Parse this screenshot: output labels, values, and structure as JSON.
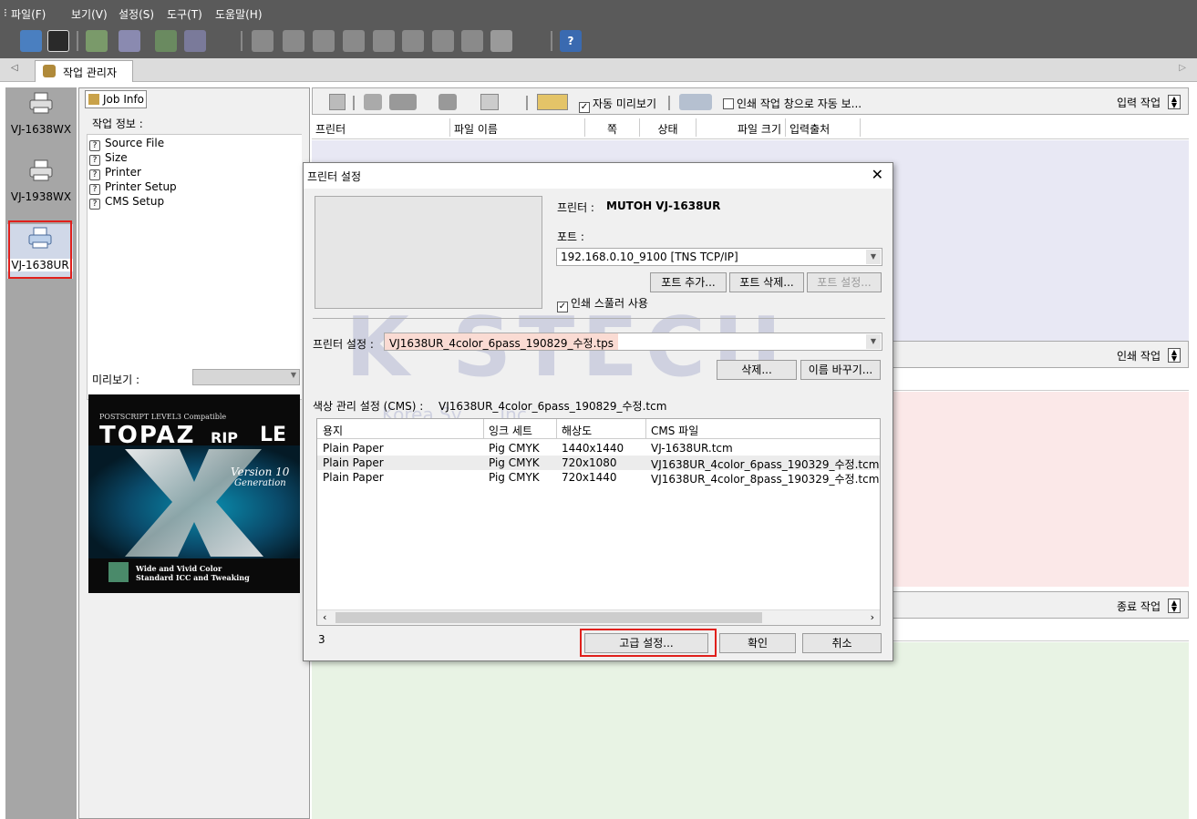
{
  "menu": [
    "파일(F)",
    "보기(V)",
    "설정(S)",
    "도구(T)",
    "도움말(H)"
  ],
  "tabs": {
    "main": "작업 관리자"
  },
  "printers": [
    {
      "label": "VJ-1638WX"
    },
    {
      "label": "VJ-1938WX"
    },
    {
      "label": "VJ-1638UR"
    }
  ],
  "job_panel": {
    "tab_label": "Job Info",
    "section_label": "작업 정보 :",
    "items": [
      "Source File",
      "Size",
      "Printer",
      "Printer Setup",
      "CMS Setup"
    ],
    "preview_label": "미리보기 :",
    "topaz": {
      "line1": "POSTSCRIPT LEVEL3 Compatible",
      "brand": "TOPAZ",
      "rip": "RIP",
      "le": "LE",
      "version": "Version 10",
      "generation": "Generation",
      "footer1": "Wide and Vivid Color",
      "footer2": "Standard ICC and Tweaking"
    }
  },
  "right": {
    "auto_preview": "자동 미리보기",
    "auto_print": "인쇄 작업 창으로 자동 보...",
    "input_jobs": "입력 작업",
    "print_jobs": "인쇄 작업",
    "done_jobs": "종료 작업",
    "columns": [
      "프린터",
      "파일 이름",
      "쪽",
      "상태",
      "파일 크기",
      "입력출처"
    ]
  },
  "dialog": {
    "title": "프린터 설정",
    "printer_label": "프린터 :",
    "printer_value": "MUTOH VJ-1638UR",
    "port_label": "포트 :",
    "port_value": "192.168.0.10_9100 [TNS TCP/IP]",
    "add_port": "포트 추가...",
    "delete_port": "포트 삭제...",
    "port_settings": "포트 설정...",
    "use_spooler": "인쇄 스풀러 사용",
    "setting_label": "프린터 설정 :",
    "setting_value": "VJ1638UR_4color_6pass_190829_수정.tps",
    "delete": "삭제...",
    "rename": "이름 바꾸기...",
    "cms_label": "색상 관리 설정 (CMS) :",
    "cms_value": "VJ1638UR_4color_6pass_190829_수정.tcm",
    "list_headers": [
      "용지",
      "잉크 세트",
      "해상도",
      "CMS 파일"
    ],
    "list_rows": [
      [
        "Plain Paper",
        "Pig CMYK",
        "1440x1440",
        "VJ-1638UR.tcm"
      ],
      [
        "Plain Paper",
        "Pig CMYK",
        "720x1080",
        "VJ1638UR_4color_6pass_190329_수정.tcm"
      ],
      [
        "Plain Paper",
        "Pig CMYK",
        "720x1440",
        "VJ1638UR_4color_8pass_190329_수정.tcm"
      ]
    ],
    "count": "3",
    "advanced": "고급 설정...",
    "ok": "확인",
    "cancel": "취소"
  },
  "watermark": {
    "text": "K STECH",
    "sub": "Korea Sy... ...Inc"
  },
  "colors": {
    "toolbar": "#5a5a5a",
    "input_bg": "#e8e8f4",
    "print_bg": "#fbe8e8",
    "done_bg": "#e8f3e4",
    "highlight": "#e0201c",
    "selected_field": "#fadbd3"
  }
}
